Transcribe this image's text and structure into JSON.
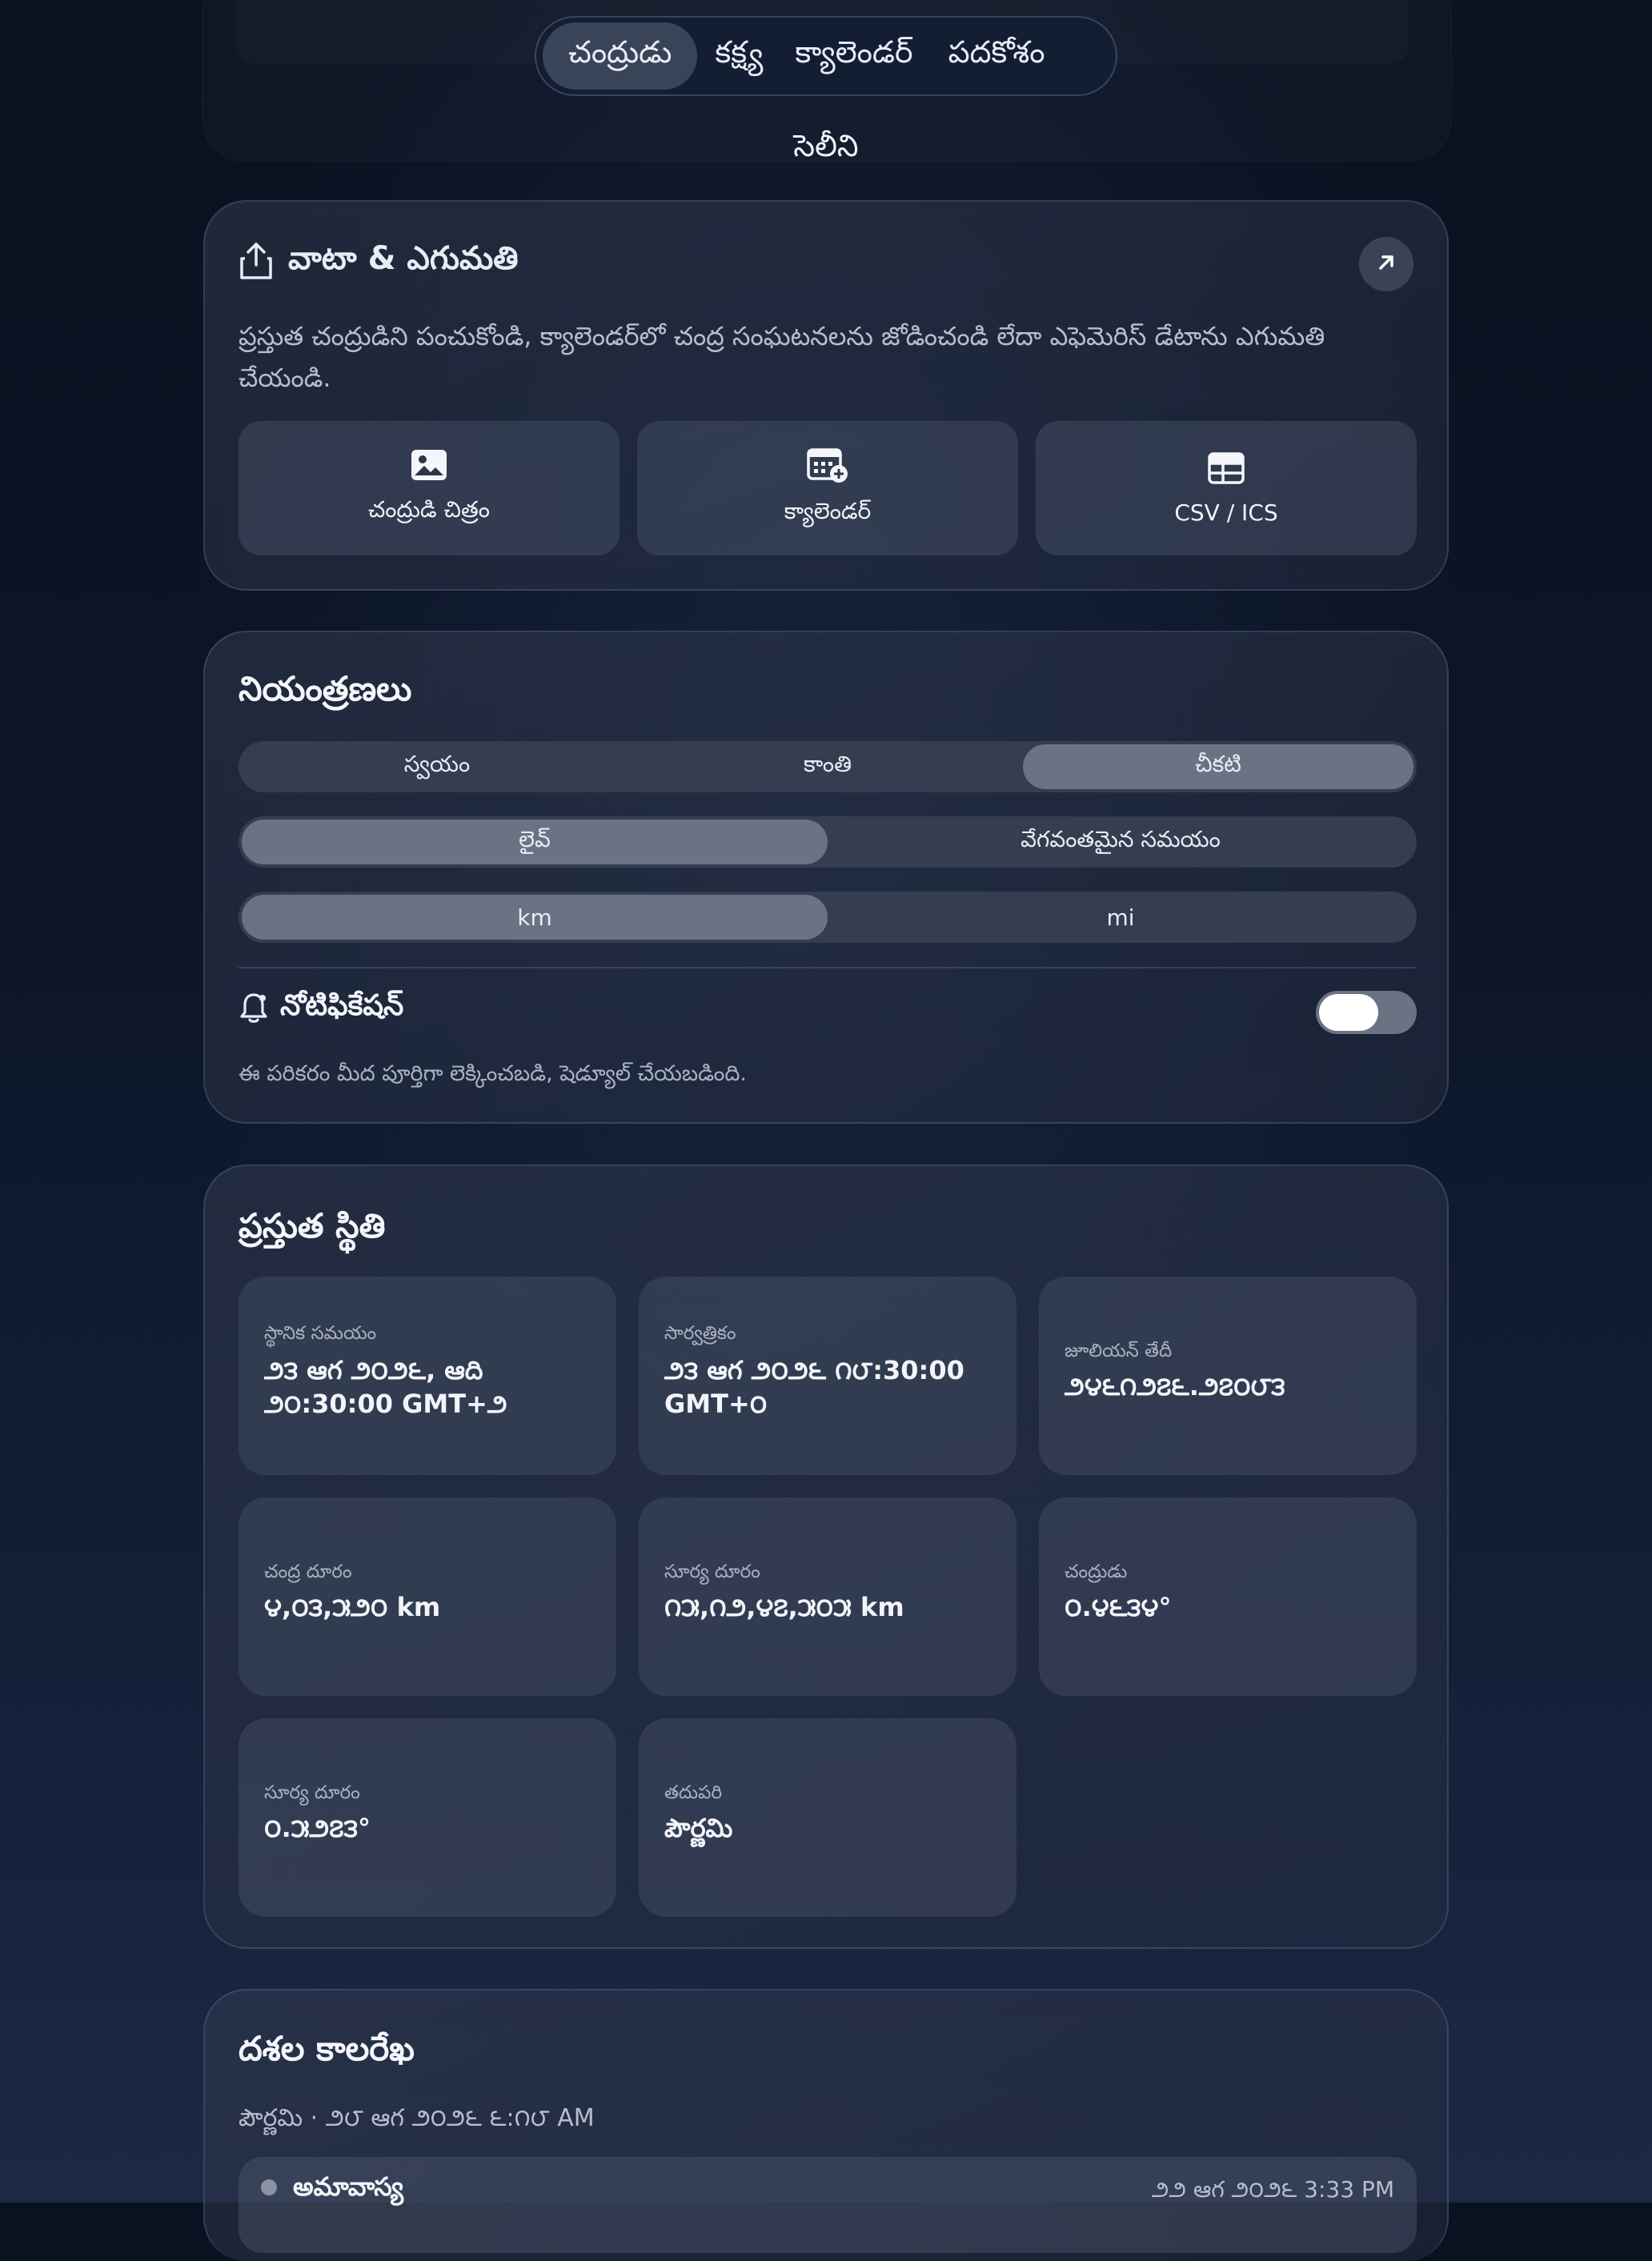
{
  "nav": {
    "tabs": [
      {
        "label": "చంద్రుడు",
        "active": true
      },
      {
        "label": "కక్ష్య",
        "active": false
      },
      {
        "label": "క్యాలెండర్",
        "active": false
      },
      {
        "label": "పదకోశం",
        "active": false
      }
    ],
    "subtitle": "సెలీని"
  },
  "share": {
    "title": "వాటా & ఎగుమతి",
    "description": "ప్రస్తుత చంద్రుడిని పంచుకోండి, క్యాలెండర్‌లో చంద్ర సంఘటనలను జోడించండి లేదా ఎఫెమెరిస్ డేటాను ఎగుమతి చేయండి.",
    "actions": [
      {
        "label": "చంద్రుడి చిత్రం",
        "icon": "image-icon"
      },
      {
        "label": "క్యాలెండర్",
        "icon": "calendar-add-icon"
      },
      {
        "label": "CSV / ICS",
        "icon": "table-icon"
      }
    ]
  },
  "controls": {
    "title": "నియంత్రణలు",
    "theme": {
      "options": [
        "స్వయం",
        "కాంతి",
        "చీకటి"
      ],
      "selected": "చీకటి"
    },
    "mode": {
      "options": [
        "లైవ్",
        "వేగవంతమైన సమయం"
      ],
      "selected": "లైవ్"
    },
    "units": {
      "options": [
        "km",
        "mi"
      ],
      "selected": "km"
    },
    "notifications": {
      "label": "నోటిఫికేషన్",
      "enabled": true,
      "note": "ఈ పరికరం మీద పూర్తిగా లెక్కించబడి, షెడ్యూల్ చేయబడింది."
    }
  },
  "status": {
    "title": "ప్రస్తుత స్థితి",
    "tiles": [
      {
        "label": "స్థానిక సమయం",
        "value": "౨౩ ఆగ ౨౦౨౬, ఆది ౨౦:30:00 GMT+౨"
      },
      {
        "label": "సార్వత్రికం",
        "value": "౨౩ ఆగ ౨౦౨౬ ౧౮:30:00 GMT+౦"
      },
      {
        "label": "జూలియన్ తేదీ",
        "value": "౨౪౬౧౨౭౬.౨౭౦౮౩"
      },
      {
        "label": "చంద్ర దూరం",
        "value": "౪,౦౩,౫౨౦ km"
      },
      {
        "label": "సూర్య దూరం",
        "value": "౧౫,౧౨,౪౭,౫౦౫ km"
      },
      {
        "label": "చంద్రుడు",
        "value": "౦.౪౬౩౪°"
      },
      {
        "label": "సూర్య దూరం",
        "value": "౦.౫౨౭౩°"
      },
      {
        "label": "తదుపరి",
        "value": "పౌర్ణమి"
      }
    ]
  },
  "timeline": {
    "title": "దశల కాలరేఖ",
    "next": "పౌర్ణమి · ౨౮ ఆగ ౨౦౨౬ ౬:౧౮ AM",
    "first_row_name": "అమావాస్య",
    "first_row_date": "౨౨ ఆగ ౨౦౨౬ 3:33 PM"
  },
  "colors": {
    "accent_active": "#6b7284",
    "card": "#2c3447",
    "background": "#0c1527"
  }
}
